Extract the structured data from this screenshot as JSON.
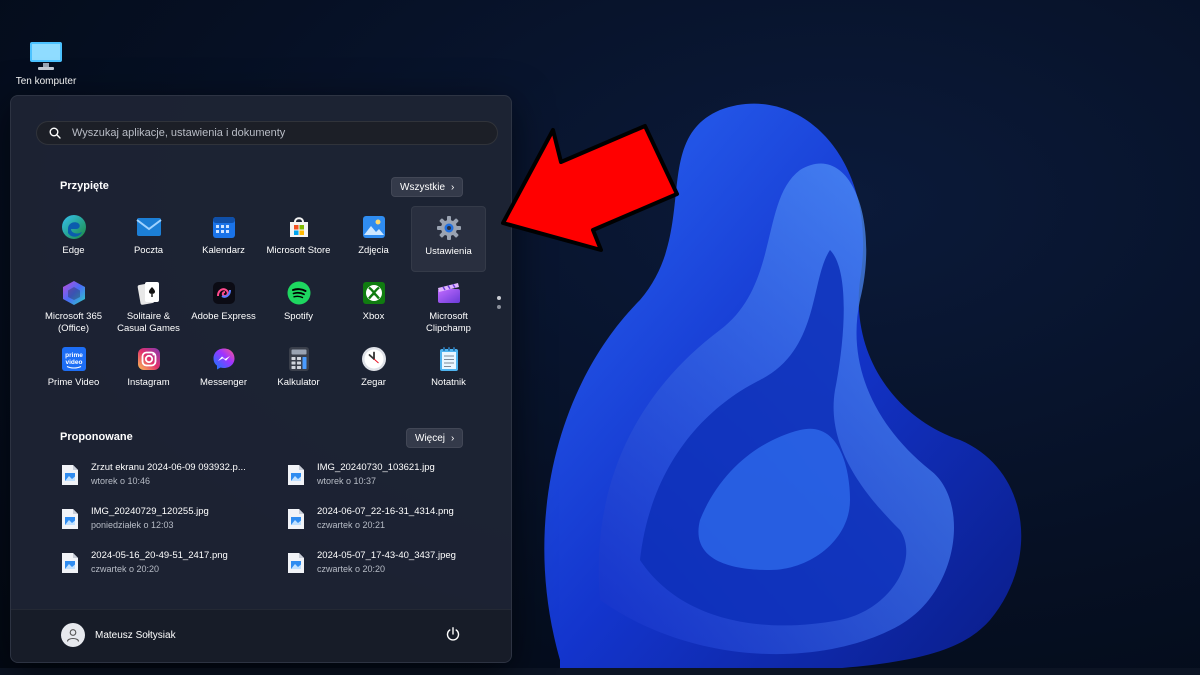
{
  "desktop": {
    "icons": [
      {
        "label": "Ten komputer",
        "icon": "monitor-icon"
      }
    ]
  },
  "search": {
    "placeholder": "Wyszukaj aplikacje, ustawienia i dokumenty",
    "icon": "search-icon"
  },
  "pinned": {
    "title": "Przypięte",
    "all_button": "Wszystkie",
    "apps": [
      {
        "label": "Edge",
        "icon": "edge-icon"
      },
      {
        "label": "Poczta",
        "icon": "mail-icon"
      },
      {
        "label": "Kalendarz",
        "icon": "calendar-icon"
      },
      {
        "label": "Microsoft Store",
        "icon": "store-icon"
      },
      {
        "label": "Zdjęcia",
        "icon": "photos-icon"
      },
      {
        "label": "Ustawienia",
        "icon": "gear-icon"
      },
      {
        "label": "Microsoft 365\n(Office)",
        "icon": "m365-icon"
      },
      {
        "label": "Solitaire &\nCasual Games",
        "icon": "cards-icon"
      },
      {
        "label": "Adobe Express",
        "icon": "adobe-express-icon"
      },
      {
        "label": "Spotify",
        "icon": "spotify-icon"
      },
      {
        "label": "Xbox",
        "icon": "xbox-icon"
      },
      {
        "label": "Microsoft\nClipchamp",
        "icon": "clipchamp-icon"
      },
      {
        "label": "Prime Video",
        "icon": "prime-video-icon"
      },
      {
        "label": "Instagram",
        "icon": "instagram-icon"
      },
      {
        "label": "Messenger",
        "icon": "messenger-icon"
      },
      {
        "label": "Kalkulator",
        "icon": "calculator-icon"
      },
      {
        "label": "Zegar",
        "icon": "clock-icon"
      },
      {
        "label": "Notatnik",
        "icon": "notepad-icon"
      }
    ]
  },
  "recommended": {
    "title": "Proponowane",
    "more_button": "Więcej",
    "items": [
      {
        "name": "Zrzut ekranu 2024-06-09 093932.p...",
        "time": "wtorek o 10:46"
      },
      {
        "name": "IMG_20240730_103621.jpg",
        "time": "wtorek o 10:37"
      },
      {
        "name": "IMG_20240729_120255.jpg",
        "time": "poniedziałek o 12:03"
      },
      {
        "name": "2024-06-07_22-16-31_4314.png",
        "time": "czwartek o 20:21"
      },
      {
        "name": "2024-05-16_20-49-51_2417.png",
        "time": "czwartek o 20:20"
      },
      {
        "name": "2024-05-07_17-43-40_3437.jpeg",
        "time": "czwartek o 20:20"
      }
    ]
  },
  "footer": {
    "user_name": "Mateusz Sołtysiak",
    "power_icon": "power-icon"
  },
  "colors": {
    "accent": "#1f6fe0",
    "arrow": "#ff0000",
    "menu_bg": "#1e2434"
  }
}
